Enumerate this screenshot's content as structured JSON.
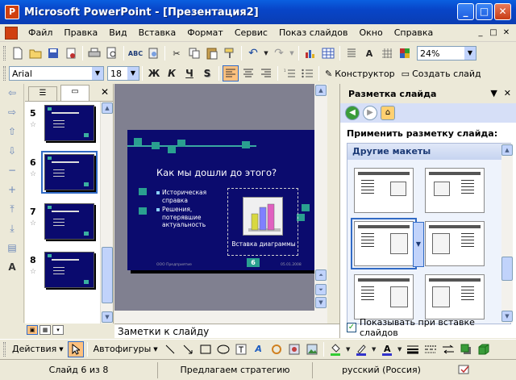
{
  "window": {
    "title": "Microsoft PowerPoint - [Презентация2]",
    "app_icon": "P",
    "minimize": "_",
    "maximize": "□",
    "close": "✕"
  },
  "menu": {
    "items": [
      "Файл",
      "Правка",
      "Вид",
      "Вставка",
      "Формат",
      "Сервис",
      "Показ слайдов",
      "Окно",
      "Справка"
    ],
    "doc_controls": [
      "_",
      "□",
      "✕"
    ]
  },
  "toolbar_standard": {
    "zoom": "24%"
  },
  "toolbar_format": {
    "font": "Arial",
    "size": "18",
    "bold": "Ж",
    "italic": "К",
    "underline": "Ч",
    "shadow": "S",
    "designer": "Конструктор",
    "new_slide": "Создать слайд"
  },
  "slides_pane": {
    "close": "✕",
    "thumbs": [
      {
        "number": "5",
        "star": "☆"
      },
      {
        "number": "6",
        "star": "☆"
      },
      {
        "number": "7",
        "star": "☆"
      },
      {
        "number": "8",
        "star": "☆"
      }
    ]
  },
  "slide": {
    "title": "Как мы дошли до этого?",
    "bullets": [
      "Историческая справка",
      "Решения, потерявшие актуальность"
    ],
    "chart_placeholder": "Вставка диаграммы",
    "footer_left": "ООО Предприятие",
    "footer_right": "05.01.2008",
    "number": "6"
  },
  "notes": {
    "placeholder": "Заметки к слайду"
  },
  "task_pane": {
    "title": "Разметка слайда",
    "dropdown": "▼",
    "close": "✕",
    "apply_label": "Применить разметку слайда:",
    "group_title": "Другие макеты",
    "show_on_insert": "Показывать при вставке слайдов",
    "show_on_insert_checked": true
  },
  "drawing_toolbar": {
    "actions": "Действия",
    "autoshapes": "Автофигуры"
  },
  "status": {
    "slide": "Слайд 6 из 8",
    "design": "Предлагаем стратегию",
    "language": "русский (Россия)"
  }
}
